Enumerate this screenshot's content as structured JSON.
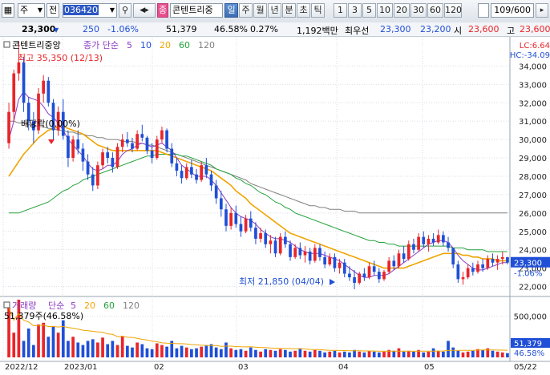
{
  "toolbar": {
    "type_select": "주",
    "type_sub": "전",
    "code": "036420",
    "name_badge": "종",
    "stock_name": "콘텐트리중",
    "periods": [
      "일",
      "주",
      "월",
      "년",
      "분",
      "초",
      "틱"
    ],
    "active_period": "일",
    "numbers": [
      "1",
      "3",
      "5",
      "10",
      "20",
      "30",
      "60",
      "120"
    ],
    "count": "109/600"
  },
  "quote": {
    "price": "23,300",
    "change": "250",
    "change_pct": "-1.06%",
    "volume": "51,379",
    "vol_ratio": "46.58%",
    "turnover": "0.27%",
    "amount": "1,192백만",
    "best_ask_label": "최우선",
    "best_ask": "23,300",
    "best_bid": "23,200",
    "open_label": "시",
    "open": "23,600",
    "high_label": "고",
    "high": "23,600"
  },
  "chart_data": {
    "type": "candlestick",
    "title": "콘텐트리중앙",
    "ma_legend": {
      "label": "종가 단순",
      "periods": [
        "5",
        "10",
        "20",
        "60",
        "120"
      ]
    },
    "x_labels": [
      "2022/12",
      "2023/01",
      "02",
      "03",
      "04",
      "05",
      "05/22"
    ],
    "y_ticks": [
      "34,000",
      "33,000",
      "32,000",
      "31,000",
      "30,000",
      "29,000",
      "28,000",
      "27,000",
      "26,000",
      "25,000",
      "24,000",
      "23,000",
      "22,000"
    ],
    "ylim": [
      21500,
      35500
    ],
    "high_annotation": "최고 35,350 (12/13)",
    "low_annotation": "최저 21,850 (04/04)",
    "event_annotation": "배당락(0.00%)",
    "current_price": "23,300",
    "current_change": "-1.06%",
    "lc_label": "LC:6.64",
    "hc_label": "HC:-34.09",
    "candles": [
      [
        29800,
        32000,
        29500,
        31500
      ],
      [
        31500,
        33800,
        31000,
        33600
      ],
      [
        33600,
        35350,
        33200,
        34200
      ],
      [
        34200,
        34500,
        31500,
        32000
      ],
      [
        32000,
        32300,
        30500,
        31000
      ],
      [
        31000,
        31500,
        29800,
        30500
      ],
      [
        30500,
        32800,
        30300,
        32500
      ],
      [
        32500,
        33500,
        32000,
        33200
      ],
      [
        33200,
        33400,
        31800,
        32000
      ],
      [
        32000,
        32200,
        30000,
        30500
      ],
      [
        30500,
        31800,
        30200,
        31500
      ],
      [
        31500,
        32200,
        30000,
        30200
      ],
      [
        30200,
        30500,
        28500,
        29000
      ],
      [
        29000,
        30200,
        28800,
        30000
      ],
      [
        30000,
        30500,
        29200,
        29500
      ],
      [
        29500,
        29800,
        28300,
        28800
      ],
      [
        28800,
        29200,
        27800,
        28100
      ],
      [
        28100,
        28500,
        27200,
        27500
      ],
      [
        27500,
        28800,
        27300,
        28600
      ],
      [
        28600,
        29500,
        28400,
        29300
      ],
      [
        29300,
        29600,
        28700,
        29000
      ],
      [
        29000,
        29300,
        28200,
        28500
      ],
      [
        28500,
        29800,
        28400,
        29600
      ],
      [
        29600,
        30300,
        29300,
        30000
      ],
      [
        30000,
        30400,
        29600,
        29800
      ],
      [
        29800,
        30100,
        29300,
        29500
      ],
      [
        29500,
        30500,
        29400,
        30300
      ],
      [
        30300,
        30800,
        29900,
        30100
      ],
      [
        30100,
        30200,
        29200,
        29400
      ],
      [
        29400,
        29800,
        28700,
        29000
      ],
      [
        29000,
        30200,
        28900,
        30000
      ],
      [
        30000,
        30700,
        29800,
        30500
      ],
      [
        30500,
        30600,
        29300,
        29500
      ],
      [
        29500,
        29800,
        28500,
        28700
      ],
      [
        28700,
        29000,
        28000,
        28300
      ],
      [
        28300,
        28600,
        27600,
        27900
      ],
      [
        27900,
        28700,
        27800,
        28500
      ],
      [
        28500,
        28900,
        27900,
        28100
      ],
      [
        28100,
        28400,
        27600,
        27800
      ],
      [
        27800,
        28800,
        27700,
        28600
      ],
      [
        28600,
        29000,
        27900,
        28100
      ],
      [
        28100,
        28300,
        27200,
        27500
      ],
      [
        27500,
        27800,
        26500,
        26800
      ],
      [
        26800,
        27200,
        25800,
        26200
      ],
      [
        26200,
        26500,
        25000,
        25300
      ],
      [
        25300,
        26300,
        25100,
        26000
      ],
      [
        26000,
        26400,
        25200,
        25400
      ],
      [
        25400,
        25800,
        24700,
        25000
      ],
      [
        25000,
        25900,
        24900,
        25700
      ],
      [
        25700,
        26100,
        25000,
        25200
      ],
      [
        25200,
        25500,
        24300,
        24600
      ],
      [
        24600,
        25200,
        24400,
        24900
      ],
      [
        24900,
        25100,
        24100,
        24300
      ],
      [
        24300,
        24800,
        23800,
        24500
      ],
      [
        24500,
        24700,
        23600,
        23800
      ],
      [
        23800,
        24900,
        23700,
        24700
      ],
      [
        24700,
        25000,
        24100,
        24300
      ],
      [
        24300,
        24500,
        23400,
        23600
      ],
      [
        23600,
        24300,
        23500,
        24100
      ],
      [
        24100,
        24400,
        23500,
        23700
      ],
      [
        23700,
        24200,
        23300,
        23900
      ],
      [
        23900,
        24100,
        23200,
        23400
      ],
      [
        23400,
        24300,
        23300,
        24100
      ],
      [
        24100,
        24300,
        23400,
        23600
      ],
      [
        23600,
        23900,
        23000,
        23200
      ],
      [
        23200,
        23800,
        23100,
        23600
      ],
      [
        23600,
        23800,
        22800,
        23000
      ],
      [
        23000,
        23500,
        22700,
        23300
      ],
      [
        23300,
        23500,
        22500,
        22700
      ],
      [
        22700,
        23100,
        22300,
        22500
      ],
      [
        22500,
        22900,
        21850,
        22200
      ],
      [
        22200,
        22800,
        22100,
        22700
      ],
      [
        22700,
        23000,
        22300,
        22500
      ],
      [
        22500,
        23300,
        22400,
        23100
      ],
      [
        23100,
        23400,
        22600,
        22800
      ],
      [
        22800,
        23000,
        22200,
        22400
      ],
      [
        22400,
        22900,
        22300,
        22800
      ],
      [
        22800,
        23600,
        22700,
        23400
      ],
      [
        23400,
        23700,
        22900,
        23100
      ],
      [
        23100,
        24000,
        23000,
        23800
      ],
      [
        23800,
        24200,
        23300,
        23500
      ],
      [
        23500,
        24500,
        23400,
        24300
      ],
      [
        24300,
        24600,
        23800,
        24000
      ],
      [
        24000,
        24900,
        23900,
        24700
      ],
      [
        24700,
        25000,
        24100,
        24300
      ],
      [
        24300,
        24800,
        23900,
        24600
      ],
      [
        24600,
        24900,
        24200,
        24400
      ],
      [
        24400,
        25100,
        24300,
        24800
      ],
      [
        24800,
        25000,
        24200,
        24400
      ],
      [
        24400,
        24700,
        23900,
        24100
      ],
      [
        24100,
        23900,
        23000,
        23200
      ],
      [
        23200,
        23400,
        22200,
        22400
      ],
      [
        22400,
        22800,
        22100,
        22500
      ],
      [
        22500,
        23200,
        22400,
        23000
      ],
      [
        23000,
        23300,
        22600,
        22800
      ],
      [
        22800,
        23400,
        22700,
        23200
      ],
      [
        23200,
        23500,
        22800,
        23000
      ],
      [
        23000,
        23700,
        22900,
        23500
      ],
      [
        23500,
        23800,
        23100,
        23300
      ],
      [
        23300,
        23700,
        22900,
        23500
      ],
      [
        23500,
        23900,
        23200,
        23600
      ],
      [
        23600,
        23600,
        23200,
        23300
      ]
    ],
    "ma5": [
      30000,
      31000,
      32200,
      32600,
      32300,
      32200,
      32100,
      31800,
      31400,
      31200,
      30900,
      30500,
      30000,
      29700,
      29400,
      29100,
      28700,
      28400,
      28300,
      28400,
      28600,
      28600,
      28800,
      29200,
      29400,
      29500,
      29700,
      29800,
      29700,
      29600,
      29700,
      29800,
      29600,
      29400,
      29000,
      28600,
      28400,
      28200,
      28000,
      28000,
      28000,
      27800,
      27500,
      27100,
      26700,
      26300,
      26000,
      25800,
      25700,
      25600,
      25400,
      25100,
      24900,
      24700,
      24600,
      24600,
      24500,
      24400,
      24200,
      24000,
      23900,
      23800,
      23800,
      23800,
      23700,
      23600,
      23500,
      23400,
      23200,
      23000,
      22800,
      22600,
      22500,
      22500,
      22600,
      22600,
      22600,
      22700,
      22900,
      23100,
      23300,
      23500,
      23700,
      23900,
      24100,
      24300,
      24400,
      24500,
      24500,
      24400,
      24100,
      23700,
      23400,
      23200,
      23000,
      22900,
      22900,
      23000,
      23100,
      23200,
      23300,
      23300
    ],
    "ma20": [
      28000,
      28400,
      28800,
      29200,
      29500,
      29800,
      30100,
      30300,
      30500,
      30600,
      30700,
      30700,
      30600,
      30500,
      30400,
      30300,
      30100,
      29900,
      29700,
      29600,
      29500,
      29400,
      29400,
      29400,
      29400,
      29400,
      29400,
      29400,
      29400,
      29400,
      29400,
      29300,
      29200,
      29100,
      29000,
      28900,
      28800,
      28700,
      28600,
      28500,
      28400,
      28300,
      28100,
      27900,
      27700,
      27500,
      27200,
      27000,
      26800,
      26500,
      26300,
      26100,
      25900,
      25700,
      25500,
      25300,
      25100,
      24900,
      24800,
      24700,
      24600,
      24500,
      24400,
      24300,
      24200,
      24100,
      24000,
      23900,
      23800,
      23700,
      23600,
      23500,
      23400,
      23300,
      23200,
      23100,
      23000,
      23000,
      23000,
      23000,
      23000,
      23100,
      23200,
      23300,
      23400,
      23500,
      23600,
      23700,
      23800,
      23800,
      23800,
      23800,
      23700,
      23700,
      23600,
      23600,
      23500,
      23500,
      23500,
      23400,
      23400,
      23400
    ],
    "ma60": [
      26000,
      26000,
      26000,
      26100,
      26200,
      26300,
      26400,
      26500,
      26600,
      26800,
      27000,
      27200,
      27300,
      27500,
      27600,
      27800,
      27900,
      28000,
      28100,
      28200,
      28300,
      28400,
      28500,
      28600,
      28700,
      28800,
      28900,
      29000,
      29100,
      29100,
      29200,
      29200,
      29200,
      29200,
      29200,
      29100,
      29100,
      29000,
      28900,
      28800,
      28700,
      28600,
      28400,
      28300,
      28200,
      28100,
      27900,
      27800,
      27600,
      27500,
      27300,
      27100,
      27000,
      26800,
      26600,
      26500,
      26300,
      26200,
      26000,
      25900,
      25800,
      25700,
      25600,
      25500,
      25400,
      25300,
      25200,
      25100,
      25000,
      24900,
      24800,
      24700,
      24600,
      24500,
      24500,
      24400,
      24400,
      24300,
      24300,
      24200,
      24200,
      24200,
      24200,
      24200,
      24200,
      24200,
      24200,
      24200,
      24200,
      24200,
      24100,
      24100,
      24100,
      24000,
      24000,
      24000,
      24000,
      23900,
      23900,
      23900,
      23900,
      23900
    ],
    "ma120": [
      31000,
      31000,
      30900,
      30900,
      30800,
      30800,
      30700,
      30700,
      30600,
      30600,
      30500,
      30500,
      30400,
      30400,
      30300,
      30300,
      30200,
      30200,
      30100,
      30100,
      30000,
      30000,
      30000,
      29900,
      29900,
      29900,
      29800,
      29800,
      29700,
      29700,
      29600,
      29500,
      29400,
      29300,
      29200,
      29100,
      29000,
      28900,
      28800,
      28700,
      28600,
      28500,
      28400,
      28300,
      28200,
      28100,
      28000,
      27900,
      27800,
      27600,
      27500,
      27400,
      27300,
      27200,
      27100,
      27000,
      26900,
      26800,
      26700,
      26600,
      26500,
      26400,
      26400,
      26300,
      26300,
      26200,
      26200,
      26200,
      26100,
      26100,
      26100,
      26000,
      26000,
      26000,
      26000,
      26000,
      26000,
      26000,
      26000,
      26000,
      26000,
      26000,
      26000,
      26000,
      26000,
      26000,
      26000,
      26000,
      26000,
      26000,
      26000,
      26000,
      26000,
      26000,
      26000,
      26000,
      26000,
      26000,
      26000,
      26000,
      26000,
      26000
    ],
    "volume": {
      "label": "거래량",
      "ma_label": "단순",
      "ma_periods": [
        "5",
        "20",
        "60",
        "120"
      ],
      "current": "51,379주(46.58%)",
      "axis_label": "500,000",
      "current_tag": "51,379",
      "pct_tag": "46.58%",
      "ylim": [
        0,
        700000
      ],
      "values": [
        600000,
        300000,
        700000,
        200000,
        350000,
        150000,
        400000,
        420000,
        250000,
        380000,
        300000,
        450000,
        200000,
        250000,
        180000,
        150000,
        200000,
        220000,
        180000,
        240000,
        160000,
        200000,
        150000,
        260000,
        140000,
        120000,
        180000,
        160000,
        110000,
        100000,
        170000,
        150000,
        130000,
        200000,
        110000,
        140000,
        120000,
        100000,
        110000,
        130000,
        140000,
        160000,
        120000,
        100000,
        180000,
        110000,
        90000,
        100000,
        80000,
        120000,
        90000,
        70000,
        100000,
        90000,
        80000,
        100000,
        90000,
        70000,
        80000,
        110000,
        80000,
        70000,
        90000,
        80000,
        60000,
        70000,
        80000,
        60000,
        70000,
        60000,
        90000,
        70000,
        60000,
        80000,
        70000,
        60000,
        70000,
        90000,
        80000,
        110000,
        70000,
        80000,
        70000,
        90000,
        60000,
        70000,
        110000,
        80000,
        70000,
        200000,
        120000,
        80000,
        60000,
        70000,
        80000,
        100000,
        90000,
        110000,
        80000,
        70000,
        60000,
        51379
      ]
    }
  },
  "colors": {
    "up": "#e8252a",
    "down": "#1f4fd6",
    "ma5": "#8a3cc6",
    "ma20": "#f0a400",
    "ma60": "#24a33c",
    "ma120": "#808080",
    "grid": "#d9dee6"
  }
}
